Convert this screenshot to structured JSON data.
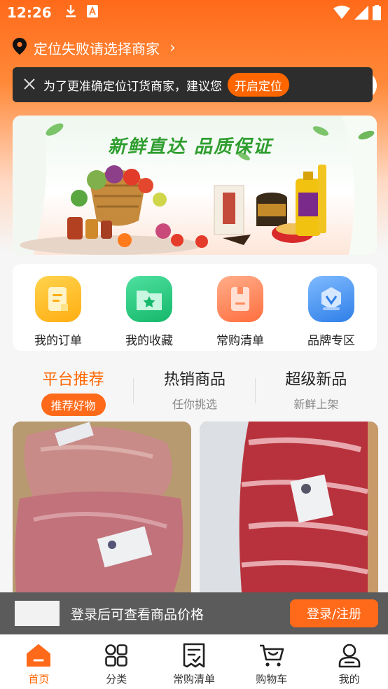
{
  "status_bar": {
    "time": "12:26",
    "icons": [
      "download-icon",
      "a-icon",
      "wifi-icon",
      "signal-icon",
      "battery-icon"
    ]
  },
  "location": {
    "text": "定位失败请选择商家",
    "icon": "location-pin-icon"
  },
  "tip": {
    "text": "为了更准确定位订货商家，建议您",
    "button": "开启定位"
  },
  "banner": {
    "headline": "新鲜直达 品质保证"
  },
  "quick_menu": [
    {
      "label": "我的订单",
      "icon": "order-icon",
      "color": "#ffb21a"
    },
    {
      "label": "我的收藏",
      "icon": "favorite-folder-icon",
      "color": "#22c47a"
    },
    {
      "label": "常购清单",
      "icon": "list-icon",
      "color": "#ff7a4a"
    },
    {
      "label": "品牌专区",
      "icon": "brand-badge-icon",
      "color": "#3d8ef0"
    }
  ],
  "tabs": [
    {
      "title": "平台推荐",
      "subtitle": "推荐好物",
      "active": true
    },
    {
      "title": "热销商品",
      "subtitle": "任你挑选",
      "active": false
    },
    {
      "title": "超级新品",
      "subtitle": "新鲜上架",
      "active": false
    }
  ],
  "login_bar": {
    "text": "登录后可查看商品价格",
    "button": "登录/注册"
  },
  "bottom_nav": [
    {
      "label": "首页",
      "icon": "home-icon",
      "active": true
    },
    {
      "label": "分类",
      "icon": "category-grid-icon",
      "active": false
    },
    {
      "label": "常购清单",
      "icon": "checklist-icon",
      "active": false
    },
    {
      "label": "购物车",
      "icon": "cart-icon",
      "active": false
    },
    {
      "label": "我的",
      "icon": "profile-icon",
      "active": false
    }
  ],
  "colors": {
    "accent": "#ff6600",
    "header_gradient_start": "#ff6a1a",
    "tip_bg": "#2d2d2d"
  }
}
